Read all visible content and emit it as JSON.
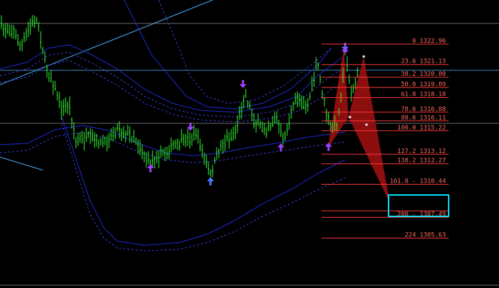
{
  "window": {
    "name": "trading-chart"
  },
  "colors": {
    "background": "#000000",
    "candle": "#33ff33",
    "band": "#1f2bd6",
    "band_dotted": "#3a3fe0",
    "trendline": "#4fb3ff",
    "fib": "#ff3b3b",
    "fib_label": "#ff6a5a",
    "harmonic_fill": "#9b0f0f",
    "marker_purple": "#a040ff",
    "marker_blue": "#4a7dff",
    "highlight_box": "#00e5ff",
    "horizontal_line": "#8a8a8a"
  },
  "chart_data": {
    "type": "candlestick",
    "fibonacci_levels": [
      {
        "ratio": "0",
        "price": "1322.96",
        "label": "0 1322.96"
      },
      {
        "ratio": "23.6",
        "price": "1321.13",
        "label": "23.6 1321.13"
      },
      {
        "ratio": "38.2",
        "price": "1320.00",
        "label": "38.2 1320.00"
      },
      {
        "ratio": "50.0",
        "price": "1319.09",
        "label": "50.0 1319.09"
      },
      {
        "ratio": "61.8",
        "price": "1318.18",
        "label": "61.8 1318.18"
      },
      {
        "ratio": "78.6",
        "price": "1316.88",
        "label": "78.6 1316.88"
      },
      {
        "ratio": "88.6",
        "price": "1316.11",
        "label": "88.6 1316.11"
      },
      {
        "ratio": "100.0",
        "price": "1315.22",
        "label": "100.0 1315.22"
      },
      {
        "ratio": "127.2",
        "price": "1313.12",
        "label": "127.2 1313.12"
      },
      {
        "ratio": "138.2",
        "price": "1312.27",
        "label": "138.2 1312.27"
      },
      {
        "ratio": "161.8",
        "price": "1310.44",
        "label": "161.8 - 1310.44"
      },
      {
        "ratio": "200",
        "price": "1307.49",
        "label": "200 - 1307.49"
      },
      {
        "ratio": "224",
        "price": "1305.63",
        "label": "224 1305.63"
      }
    ],
    "price_range": [
      1305.0,
      1324.0
    ],
    "grid": false
  }
}
